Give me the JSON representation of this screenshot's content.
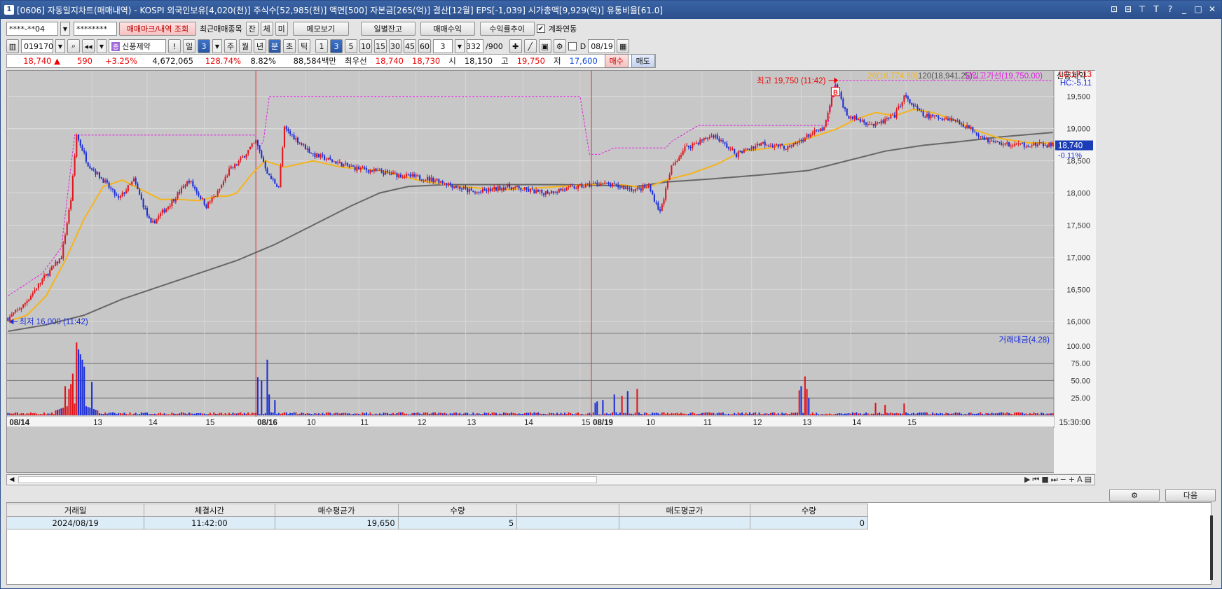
{
  "window": {
    "title_badge": "1",
    "title": "[0606] 자동일지차트(매매내역) - KOSPI 외국인보유[4,020(천)] 주식수[52,985(천)] 액면[500] 자본금[265(억)] 결산[12월] EPS[-1,039] 시가총액[9,929(억)] 유통비율[61.0]",
    "buttons": [
      "⊡",
      "⊟",
      "⊤",
      "T",
      "?",
      "_",
      "□",
      "✕"
    ]
  },
  "toolbar1": {
    "account": "****-**04",
    "password": "********",
    "mark_button": "매매마크/내역 조회",
    "recent_label": "최근매매종목",
    "tab_jan": "잔",
    "tab_che": "체",
    "tab_mi": "미",
    "memo_button": "메모보기",
    "daily_button": "일별잔고",
    "trade_profit_button": "매매수익",
    "profit_trend_button": "수익률추이",
    "account_link_label": "계좌연동",
    "account_link_checked": "✔"
  },
  "toolbar2": {
    "code": "019170",
    "stock_name": "신풍제약",
    "exclaim": "!",
    "period_il": "일",
    "period_num": "3",
    "periods": [
      "주",
      "월",
      "년"
    ],
    "period_min": "분",
    "period_cho": "초",
    "period_tick": "틱",
    "intervals": [
      "1",
      "3",
      "5",
      "10",
      "15",
      "30",
      "45",
      "60"
    ],
    "interval_selected": "3",
    "interval_input": "3",
    "count": "332",
    "count_total": "/900",
    "date_checkbox": "D",
    "date": "08/19"
  },
  "pricebar": {
    "price": "18,740",
    "arrow": "▲",
    "change": "590",
    "change_pct": "+3.25%",
    "volume": "4,672,065",
    "volume_ratio": "128.74%",
    "turnover": "8.82%",
    "amount": "88,584백만",
    "best_label": "최우선",
    "best_ask": "18,740",
    "best_bid": "18,730",
    "open_label": "시",
    "open": "18,150",
    "high_label": "고",
    "high": "19,750",
    "low_label": "저",
    "low": "17,600",
    "buy_button": "매수",
    "sell_button": "매도"
  },
  "chart_data": {
    "type": "candlestick",
    "legend": {
      "ma20": "20(18,774.50)",
      "ma120": "120(18,941.25)",
      "high_line": "당일고가선(19,750.00)",
      "stock": "신풍제약",
      "lc": "LC:17.13",
      "hc": "HC:-5.11"
    },
    "annotations": {
      "high": "최고 19,750 (11:42)",
      "low": "최저 16,000 (11:42)",
      "buy_marker": "B",
      "current_price": "18,740",
      "current_change": "-0.11%"
    },
    "y_ticks": [
      "19,500",
      "19,000",
      "18,500",
      "18,000",
      "17,500",
      "17,000",
      "16,500",
      "16,000"
    ],
    "y_values": [
      19500,
      19000,
      18500,
      18000,
      17500,
      17000,
      16500,
      16000
    ],
    "ylim": [
      15850,
      19900
    ],
    "volume_title": "거래대금(4.28)",
    "volume_ticks": [
      "100.00",
      "75.00",
      "50.00",
      "25.00"
    ],
    "volume_values": [
      100,
      75,
      50,
      25
    ],
    "x_labels": [
      "08/14",
      "13",
      "14",
      "15",
      "08/16",
      "10",
      "11",
      "12",
      "13",
      "14",
      "15",
      "08/19",
      "10",
      "11",
      "12",
      "13",
      "14",
      "15"
    ],
    "x_bold": [
      true,
      false,
      false,
      false,
      true,
      false,
      false,
      false,
      false,
      false,
      false,
      true,
      false,
      false,
      false,
      false,
      false,
      false
    ],
    "time_label": "15:30:00",
    "day_starts": [
      0,
      130,
      260,
      332
    ],
    "labels_idx": [
      0,
      44,
      73,
      103,
      130,
      156,
      184,
      214,
      240,
      270,
      300,
      306,
      334,
      364,
      390,
      416,
      442,
      471
    ],
    "waypoints": [
      [
        0,
        16050
      ],
      [
        8,
        16250
      ],
      [
        18,
        16650
      ],
      [
        28,
        17000
      ],
      [
        33,
        17900
      ],
      [
        36,
        18900
      ],
      [
        42,
        18450
      ],
      [
        50,
        18200
      ],
      [
        58,
        17900
      ],
      [
        66,
        18200
      ],
      [
        75,
        17500
      ],
      [
        84,
        17800
      ],
      [
        95,
        18200
      ],
      [
        104,
        17800
      ],
      [
        110,
        18000
      ],
      [
        116,
        18350
      ],
      [
        120,
        18450
      ],
      [
        130,
        18800
      ],
      [
        137,
        18250
      ],
      [
        142,
        18100
      ],
      [
        145,
        19000
      ],
      [
        160,
        18600
      ],
      [
        180,
        18400
      ],
      [
        200,
        18300
      ],
      [
        225,
        18200
      ],
      [
        245,
        18000
      ],
      [
        262,
        18100
      ],
      [
        280,
        18000
      ],
      [
        310,
        18150
      ],
      [
        330,
        18050
      ],
      [
        336,
        18100
      ],
      [
        342,
        17700
      ],
      [
        348,
        18400
      ],
      [
        355,
        18700
      ],
      [
        370,
        18900
      ],
      [
        382,
        18600
      ],
      [
        395,
        18780
      ],
      [
        410,
        18700
      ],
      [
        420,
        18900
      ],
      [
        428,
        19000
      ],
      [
        434,
        19700
      ],
      [
        440,
        19200
      ],
      [
        455,
        19050
      ],
      [
        465,
        19200
      ],
      [
        470,
        19500
      ],
      [
        480,
        19200
      ],
      [
        495,
        19150
      ],
      [
        505,
        19000
      ],
      [
        515,
        18800
      ],
      [
        525,
        18750
      ],
      [
        540,
        18750
      ],
      [
        548,
        18740
      ]
    ],
    "volume_spikes": [
      [
        30,
        42
      ],
      [
        32,
        38
      ],
      [
        33,
        45
      ],
      [
        34,
        60
      ],
      [
        36,
        105
      ],
      [
        37,
        95
      ],
      [
        38,
        88
      ],
      [
        39,
        80
      ],
      [
        40,
        70
      ],
      [
        44,
        48
      ],
      [
        131,
        55
      ],
      [
        133,
        50
      ],
      [
        136,
        80
      ],
      [
        137,
        30
      ],
      [
        140,
        22
      ],
      [
        308,
        18
      ],
      [
        309,
        20
      ],
      [
        312,
        22
      ],
      [
        318,
        30
      ],
      [
        322,
        28
      ],
      [
        325,
        35
      ],
      [
        330,
        38
      ],
      [
        415,
        36
      ],
      [
        416,
        42
      ],
      [
        418,
        56
      ],
      [
        419,
        38
      ],
      [
        420,
        25
      ],
      [
        455,
        18
      ],
      [
        460,
        15
      ],
      [
        470,
        17
      ]
    ],
    "ma20_points": [
      [
        0,
        16000
      ],
      [
        10,
        16100
      ],
      [
        20,
        16400
      ],
      [
        30,
        16950
      ],
      [
        40,
        17600
      ],
      [
        50,
        18100
      ],
      [
        60,
        18200
      ],
      [
        70,
        18050
      ],
      [
        80,
        17900
      ],
      [
        90,
        17900
      ],
      [
        100,
        17880
      ],
      [
        110,
        17950
      ],
      [
        115,
        17950
      ],
      [
        120,
        18000
      ],
      [
        128,
        18300
      ],
      [
        135,
        18500
      ],
      [
        145,
        18400
      ],
      [
        160,
        18500
      ],
      [
        175,
        18400
      ],
      [
        195,
        18350
      ],
      [
        215,
        18200
      ],
      [
        235,
        18100
      ],
      [
        260,
        18050
      ],
      [
        290,
        18100
      ],
      [
        315,
        18150
      ],
      [
        335,
        18080
      ],
      [
        345,
        18200
      ],
      [
        358,
        18300
      ],
      [
        372,
        18450
      ],
      [
        385,
        18650
      ],
      [
        400,
        18700
      ],
      [
        415,
        18800
      ],
      [
        425,
        18900
      ],
      [
        435,
        19000
      ],
      [
        445,
        19150
      ],
      [
        455,
        19250
      ],
      [
        465,
        19200
      ],
      [
        475,
        19300
      ],
      [
        485,
        19250
      ],
      [
        495,
        19150
      ],
      [
        505,
        19000
      ],
      [
        520,
        18850
      ],
      [
        535,
        18780
      ],
      [
        548,
        18774
      ]
    ],
    "ma120_points": [
      [
        0,
        15850
      ],
      [
        20,
        15950
      ],
      [
        40,
        16100
      ],
      [
        60,
        16350
      ],
      [
        80,
        16550
      ],
      [
        100,
        16750
      ],
      [
        120,
        16950
      ],
      [
        140,
        17200
      ],
      [
        160,
        17500
      ],
      [
        180,
        17800
      ],
      [
        195,
        18000
      ],
      [
        210,
        18100
      ],
      [
        230,
        18130
      ],
      [
        260,
        18130
      ],
      [
        290,
        18130
      ],
      [
        310,
        18120
      ],
      [
        330,
        18100
      ],
      [
        345,
        18170
      ],
      [
        370,
        18220
      ],
      [
        395,
        18280
      ],
      [
        420,
        18350
      ],
      [
        440,
        18500
      ],
      [
        460,
        18650
      ],
      [
        480,
        18740
      ],
      [
        500,
        18800
      ],
      [
        520,
        18870
      ],
      [
        548,
        18941
      ]
    ],
    "high_line_value": 19750,
    "daily_high_steps": [
      [
        0,
        16400
      ],
      [
        18,
        16750
      ],
      [
        28,
        17150
      ],
      [
        35,
        18900
      ],
      [
        130,
        18900
      ],
      [
        130,
        18650
      ],
      [
        134,
        18800
      ],
      [
        137,
        19500
      ],
      [
        300,
        19500
      ],
      [
        305,
        18600
      ],
      [
        310,
        18600
      ],
      [
        318,
        18700
      ],
      [
        345,
        18700
      ],
      [
        348,
        18800
      ],
      [
        362,
        19050
      ],
      [
        430,
        19050
      ],
      [
        434,
        19750
      ],
      [
        548,
        19750
      ]
    ]
  },
  "bottom": {
    "gear_button": "⚙",
    "next_button": "다음"
  },
  "table": {
    "headers": [
      "거래일",
      "체결시간",
      "매수평균가",
      "수량",
      "",
      "매도평균가",
      "수량"
    ],
    "rows": [
      [
        "2024/08/19",
        "11:42:00",
        "19,650",
        "5",
        "",
        "",
        "0"
      ]
    ]
  }
}
